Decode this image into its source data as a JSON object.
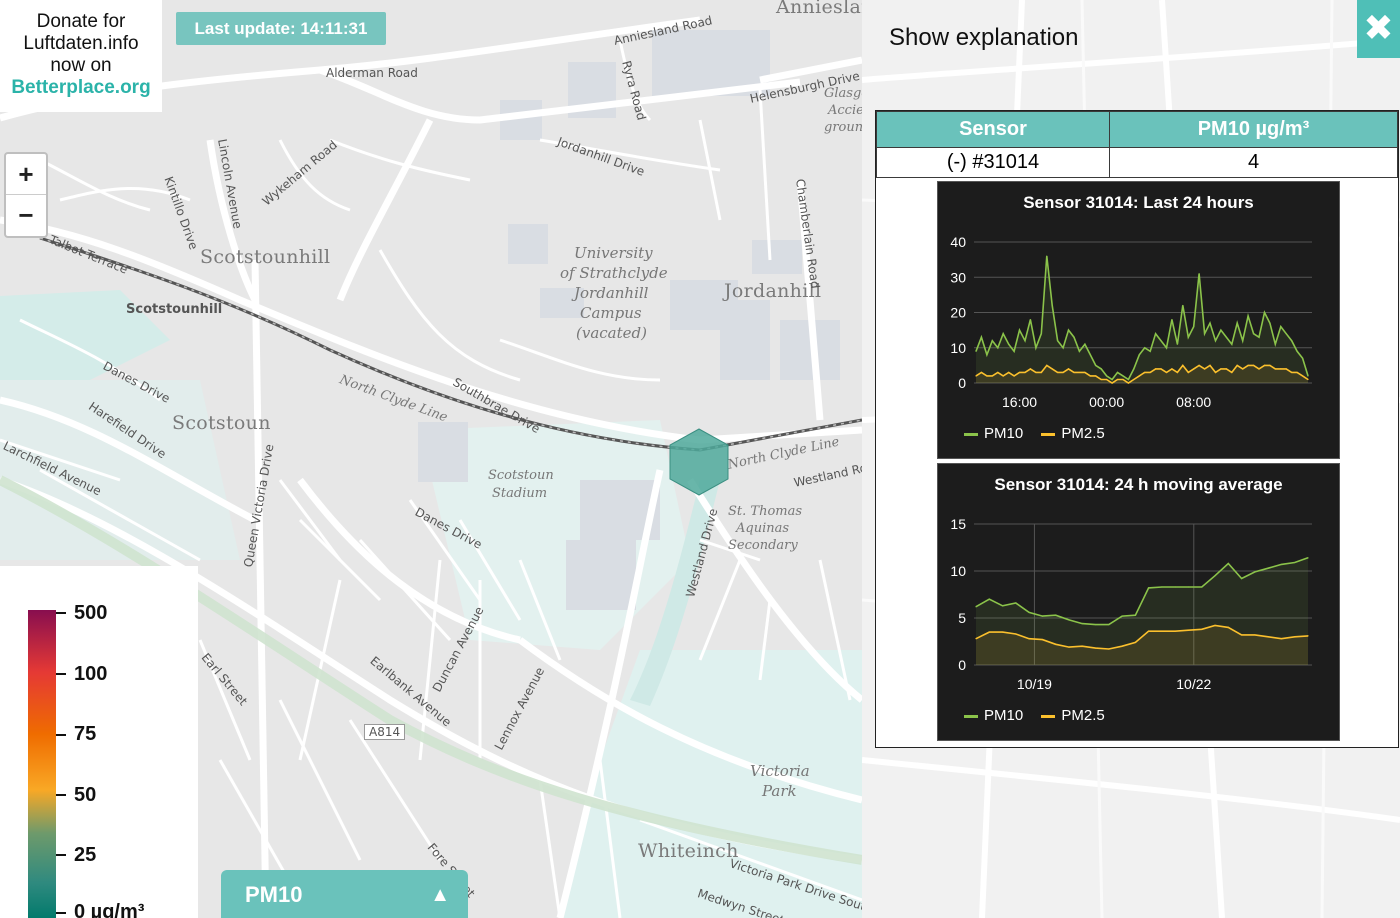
{
  "donate": {
    "line1": "Donate for",
    "line2": "Luftdaten.info",
    "line3": "now on",
    "link": "Betterplace.org"
  },
  "last_update": "Last update: 14:11:31",
  "zoom": {
    "in": "+",
    "out": "−"
  },
  "legend": {
    "labels": [
      "500",
      "100",
      "75",
      "50",
      "25",
      "0 µg/m³"
    ],
    "colors": [
      "#880e4f",
      "#e53935",
      "#ef6c00",
      "#f9a825",
      "#6e9a6b",
      "#00796b"
    ]
  },
  "selector": {
    "label": "PM10",
    "arrow": "▲"
  },
  "map_labels": {
    "scotstounhill_area": "Scotstounhill",
    "scotstounhill_station": "Scotstounhill",
    "scotstoun": "Scotstoun",
    "jordanhill": "Jordanhill",
    "whiteinch": "Whiteinch",
    "anniesland": "Anniesland",
    "university": "University",
    "of_strathclyde": "of Strathclyde",
    "jordanhill_campus": "Jordanhill",
    "campus": "Campus",
    "vacated": "(vacated)",
    "scotstoun_stadium1": "Scotstoun",
    "scotstoun_stadium2": "Stadium",
    "st_thomas1": "St. Thomas",
    "st_thomas2": "Aquinas",
    "st_thomas3": "Secondary",
    "victoria_park1": "Victoria",
    "victoria_park2": "Park",
    "glasgow_acc1": "Glasgo",
    "glasgow_acc2": "Accie",
    "glasgow_acc3": "groun",
    "road_a814": "A814",
    "road_annies": "Anniesland Road",
    "road_alderman": "Alderman Road",
    "road_helens": "Helensburgh Drive",
    "road_ryra": "Ryra Road",
    "road_lincoln": "Lincoln Avenue",
    "road_danes": "Danes Drive",
    "road_danes2": "Danes Drive",
    "road_northclyde": "North Clyde Line",
    "road_northclyde2": "North Clyde Line",
    "road_queen": "Queen Victoria Drive",
    "road_westland": "Westland Drive",
    "road_southbrae": "Southbrae Drive",
    "road_jordanhill": "Jordanhill Drive",
    "road_earlbank": "Earlbank Avenue",
    "road_victoria": "Victoria Park Drive South",
    "road_larchfield": "Larchfield Avenue",
    "road_harefield": "Harefield Drive",
    "road_chamberlain": "Chamberlain Road",
    "road_westland_rd": "Westland Road",
    "road_fore": "Fore Street",
    "road_earl": "Earl Street",
    "road_medwyn": "Medwyn Street",
    "road_lennox": "Lennox Avenue",
    "road_duncan": "Duncan Avenue",
    "road_kintillo": "Kintillo Drive",
    "road_talbot": "Talbot Terrace",
    "road_wykeham": "Wykeham Road"
  },
  "panel": {
    "show_explanation": "Show explanation",
    "close": "✖",
    "table": {
      "headers": [
        "Sensor",
        "PM10 µg/m³"
      ],
      "rows": [
        [
          "(-) #31014",
          "4"
        ]
      ]
    }
  },
  "colors": {
    "accent": "#6ac2bb",
    "pm10": "#8bc34a",
    "pm25": "#fbc02d",
    "hex": "#4fa99b"
  },
  "chart_data": [
    {
      "type": "line",
      "title": "Sensor 31014: Last 24 hours",
      "xlabel": "",
      "ylabel": "",
      "ylim": [
        0,
        40
      ],
      "yticks": [
        0,
        10,
        20,
        30,
        40
      ],
      "xticks": [
        "16:00",
        "00:00",
        "08:00"
      ],
      "x_hours": [
        12,
        12.5,
        13,
        13.5,
        14,
        14.5,
        15,
        15.5,
        16,
        16.5,
        17,
        17.5,
        18,
        18.5,
        19,
        19.5,
        20,
        20.5,
        21,
        21.5,
        22,
        22.5,
        23,
        23.5,
        24,
        24.5,
        25,
        25.5,
        26,
        26.5,
        27,
        27.5,
        28,
        28.5,
        29,
        29.5,
        30,
        30.5,
        31,
        31.5,
        32,
        32.5,
        33,
        33.5,
        34,
        34.5,
        35,
        35.5,
        36,
        36.5,
        37,
        37.5,
        38,
        38.5,
        39,
        39.5,
        40,
        40.5,
        41,
        41.5,
        42,
        42.5
      ],
      "series": [
        {
          "name": "PM10",
          "values": [
            9,
            13,
            8,
            12,
            10,
            14,
            11,
            9,
            15,
            12,
            18,
            10,
            14,
            36,
            22,
            12,
            10,
            15,
            13,
            9,
            11,
            8,
            5,
            4,
            2,
            1,
            3,
            2,
            1,
            4,
            8,
            10,
            9,
            14,
            12,
            10,
            18,
            11,
            22,
            13,
            16,
            31,
            14,
            17,
            12,
            15,
            13,
            11,
            17,
            12,
            19,
            14,
            13,
            20,
            17,
            11,
            16,
            14,
            12,
            9,
            7,
            2
          ]
        },
        {
          "name": "PM2.5",
          "values": [
            2,
            3,
            2,
            2,
            3,
            2,
            3,
            2,
            3,
            3,
            4,
            3,
            3,
            5,
            4,
            3,
            3,
            4,
            3,
            3,
            3,
            2,
            2,
            1,
            1,
            0,
            1,
            1,
            0,
            1,
            2,
            3,
            3,
            4,
            4,
            3,
            4,
            3,
            5,
            3,
            4,
            5,
            4,
            5,
            3,
            4,
            4,
            3,
            5,
            4,
            5,
            5,
            4,
            5,
            5,
            4,
            4,
            4,
            3,
            3,
            2,
            1
          ]
        }
      ]
    },
    {
      "type": "line",
      "title": "Sensor 31014: 24 h moving average",
      "xlabel": "",
      "ylabel": "",
      "ylim": [
        0,
        15
      ],
      "yticks": [
        0,
        5,
        10,
        15
      ],
      "xticks": [
        "10/19",
        "10/22"
      ],
      "x_days": [
        18,
        18.25,
        18.5,
        18.75,
        19,
        19.25,
        19.5,
        19.75,
        20,
        20.25,
        20.5,
        20.75,
        21,
        21.25,
        21.5,
        21.75,
        22,
        22.25,
        22.5,
        22.75,
        23,
        23.25,
        23.5,
        23.75,
        24,
        24.25
      ],
      "series": [
        {
          "name": "PM10",
          "values": [
            6.2,
            7,
            6.3,
            6.6,
            5.6,
            5.2,
            5.3,
            4.8,
            4.4,
            4.3,
            4.3,
            5.2,
            5.3,
            8.2,
            8.3,
            8.3,
            8.3,
            8.3,
            9.5,
            10.8,
            9.2,
            9.9,
            10.3,
            10.7,
            10.9,
            11.4
          ]
        },
        {
          "name": "PM2.5",
          "values": [
            2.8,
            3.5,
            3.5,
            3.3,
            2.8,
            2.7,
            2.2,
            1.9,
            2.0,
            1.8,
            1.7,
            2.0,
            2.4,
            3.6,
            3.6,
            3.6,
            3.7,
            3.8,
            4.2,
            4.0,
            3.2,
            3.2,
            3.0,
            2.8,
            3.0,
            3.1
          ]
        }
      ]
    }
  ]
}
